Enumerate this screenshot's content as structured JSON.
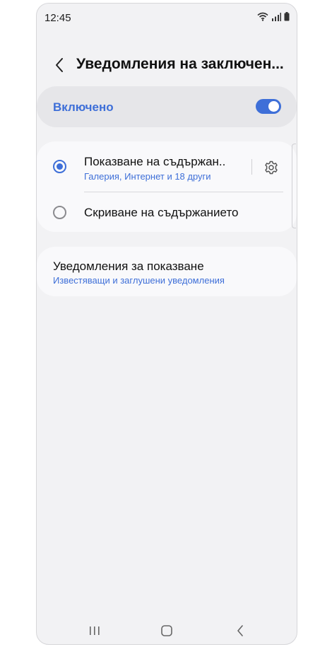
{
  "status_bar": {
    "time": "12:45"
  },
  "header": {
    "title": "Уведомления на заключен..."
  },
  "master_switch": {
    "label": "Включено",
    "state": "on"
  },
  "options": [
    {
      "title": "Показване на съдържан..",
      "subtitle": "Галерия, Интернет и 18 други",
      "selected": true
    },
    {
      "title": "Скриване на съдържанието",
      "selected": false
    }
  ],
  "notifications_to_show": {
    "title": "Уведомления за показване",
    "subtitle": "Известяващи и заглушени уведомления"
  },
  "nav_bar": {
    "items": [
      "recents-icon",
      "home-icon",
      "back-icon"
    ]
  },
  "colors": {
    "accent": "#3e6fd8",
    "background": "#f2f2f4",
    "card": "#f9f9fb"
  }
}
